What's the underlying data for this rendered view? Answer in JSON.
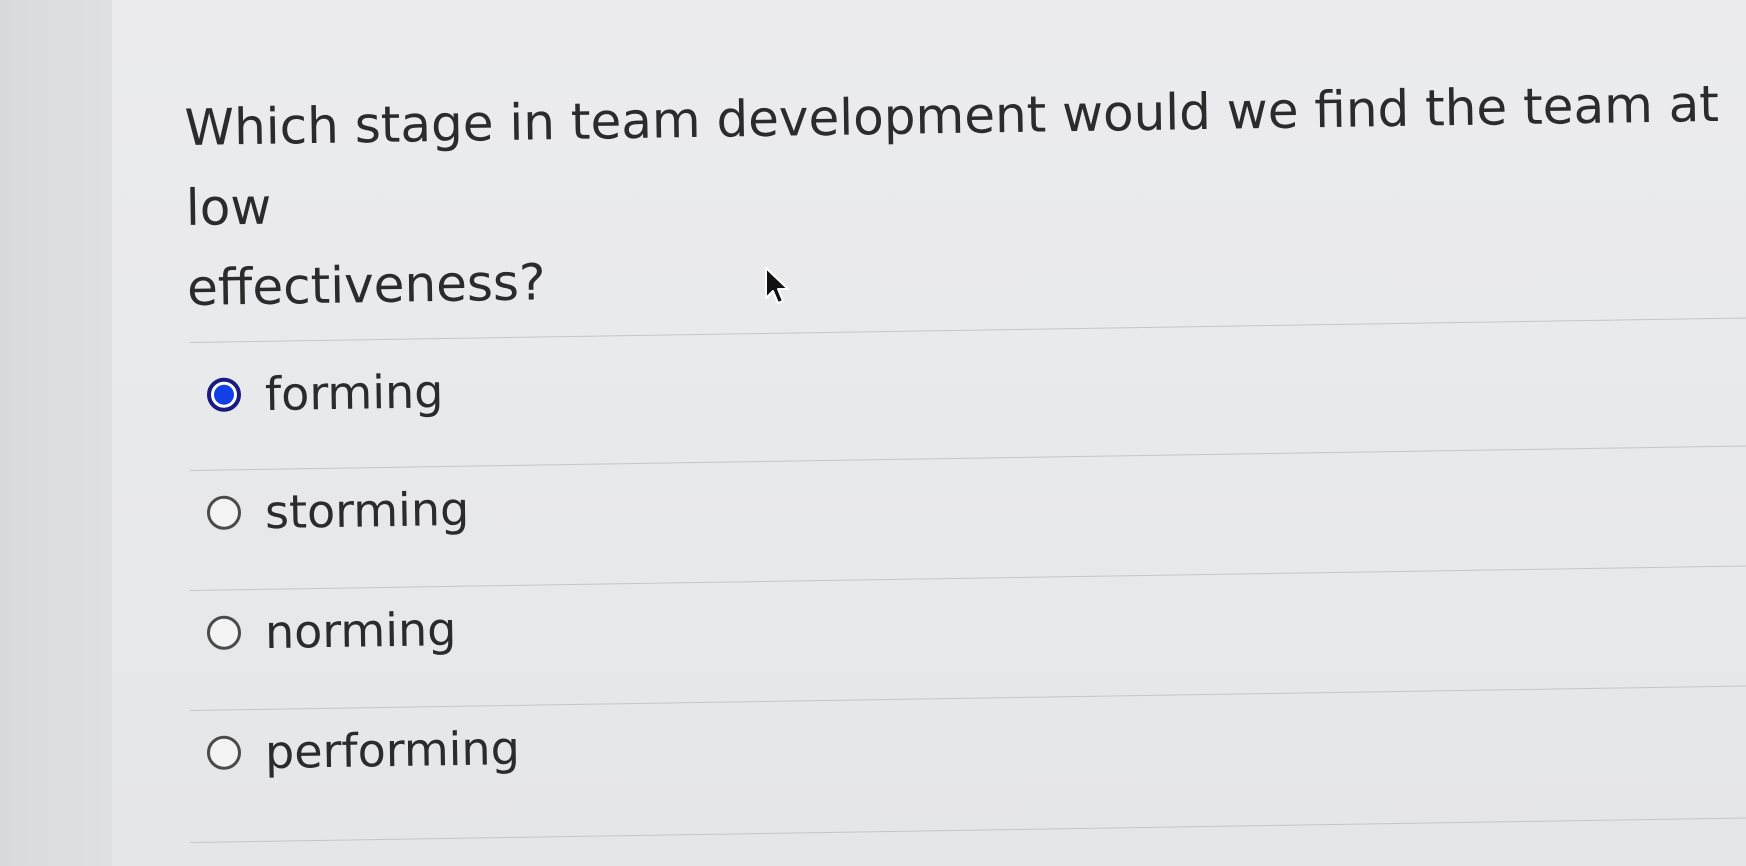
{
  "question": {
    "text_line1": "Which stage in team development would we find the team at low",
    "text_line2": "effectiveness?"
  },
  "options": [
    {
      "label": "forming",
      "selected": true
    },
    {
      "label": "storming",
      "selected": false
    },
    {
      "label": "norming",
      "selected": false
    },
    {
      "label": "performing",
      "selected": false
    }
  ],
  "colors": {
    "selected_radio": "#1140e6",
    "text": "#2b2b2b",
    "background": "#e8e9eb"
  },
  "icons": {
    "cursor": "mouse-pointer-icon"
  }
}
